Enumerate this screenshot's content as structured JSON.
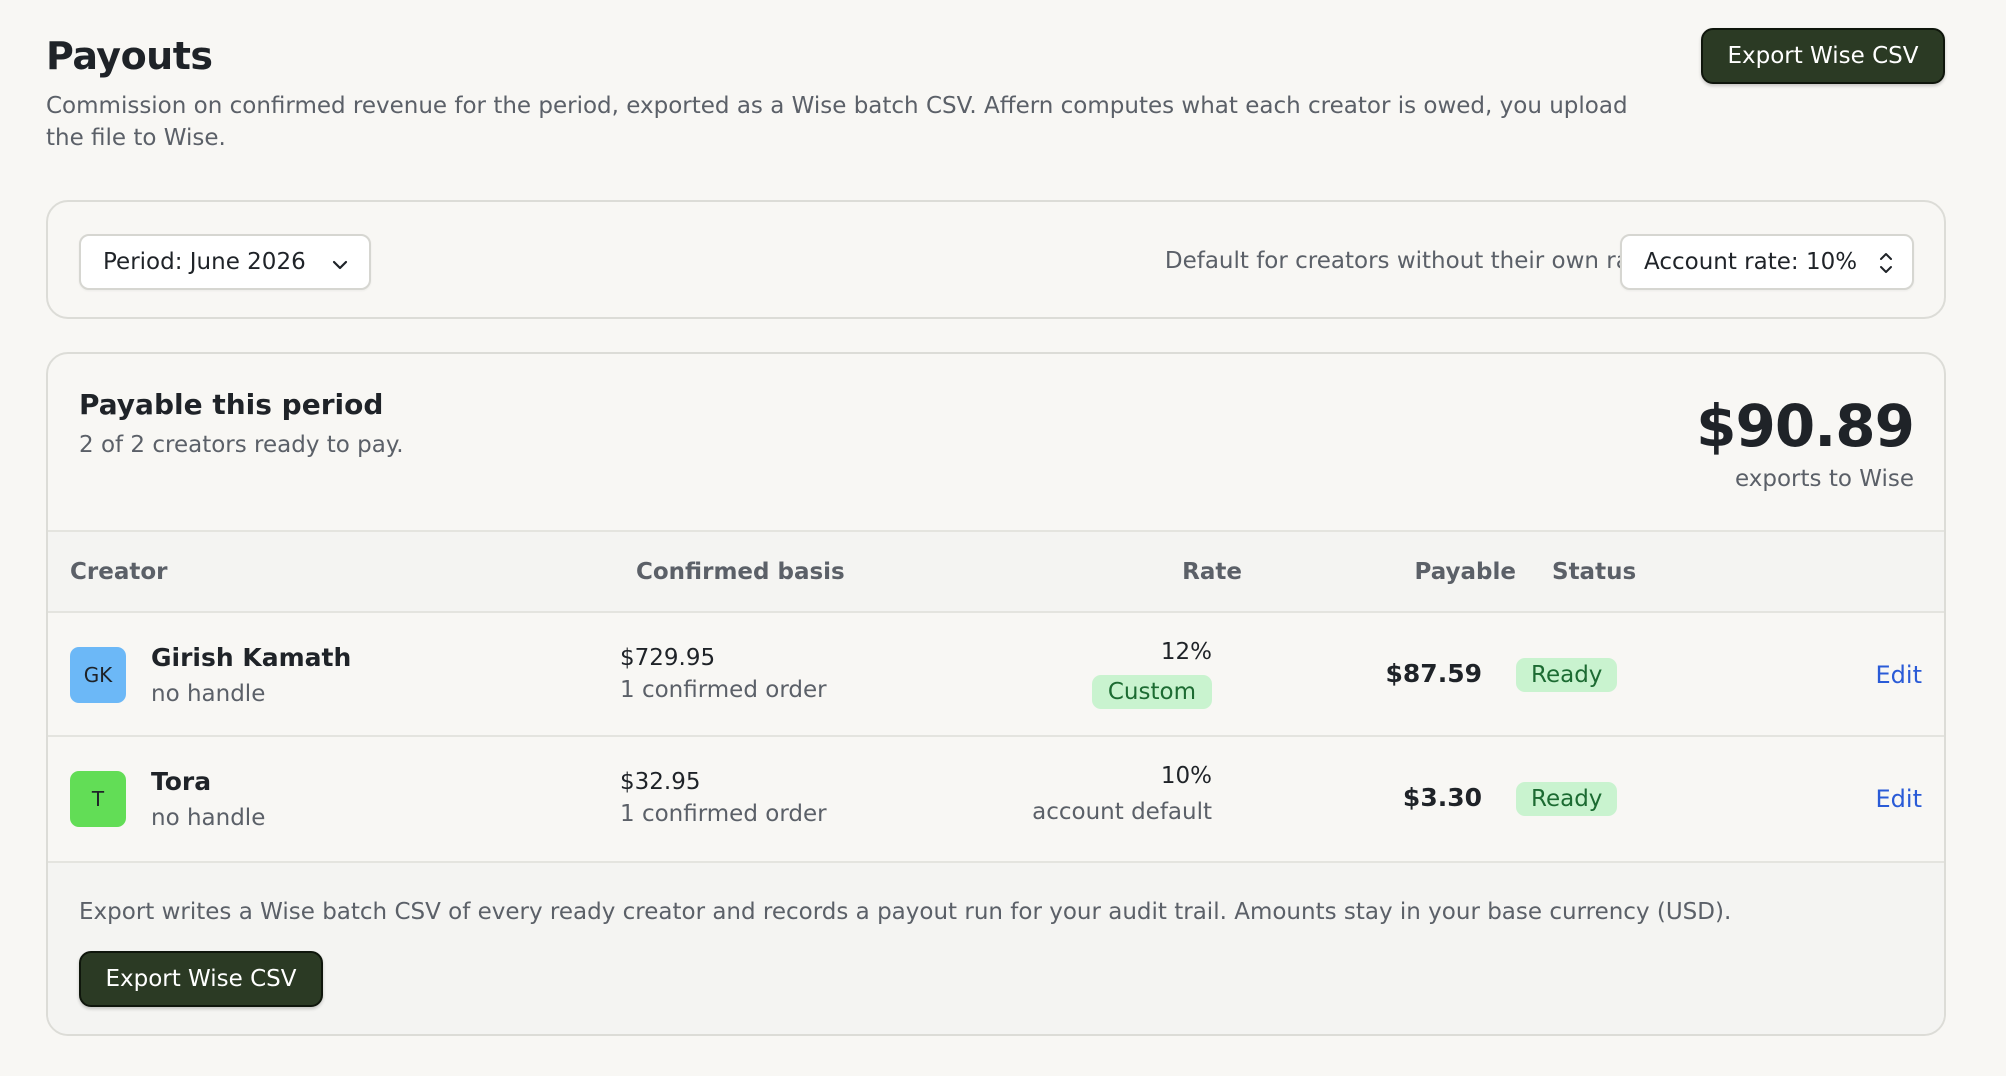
{
  "header": {
    "title": "Payouts",
    "subtitle": "Commission on confirmed revenue for the period, exported as a Wise batch CSV. Affern computes what each creator is owed, you upload the file to Wise.",
    "export_label": "Export Wise CSV"
  },
  "filters": {
    "period_label": "Period: June 2026",
    "rate_hint": "Default for creators without their own rate",
    "account_rate_label": "Account rate: 10%"
  },
  "summary": {
    "title": "Payable this period",
    "subtitle": "2 of 2 creators ready to pay.",
    "total": "$90.89",
    "total_caption": "exports to Wise"
  },
  "table": {
    "columns": {
      "creator": "Creator",
      "basis": "Confirmed basis",
      "rate": "Rate",
      "payable": "Payable",
      "status": "Status"
    },
    "rows": [
      {
        "initials": "GK",
        "avatar_color": "#6cb8f7",
        "name": "Girish Kamath",
        "handle": "no handle",
        "basis": "$729.95",
        "orders": "1 confirmed order",
        "rate": "12%",
        "rate_note": "Custom",
        "payable": "$87.59",
        "status": "Ready",
        "action": "Edit"
      },
      {
        "initials": "T",
        "avatar_color": "#62dd56",
        "name": "Tora",
        "handle": "no handle",
        "basis": "$32.95",
        "orders": "1 confirmed order",
        "rate": "10%",
        "rate_note": "account default",
        "payable": "$3.30",
        "status": "Ready",
        "action": "Edit"
      }
    ]
  },
  "footer": {
    "note": "Export writes a Wise batch CSV of every ready creator and records a payout run for your audit trail. Amounts stay in your base currency (USD).",
    "export_label": "Export Wise CSV"
  },
  "colors": {
    "accent_dark": "#2b3a24",
    "ready_bg": "#c9f3cf",
    "link": "#2a5bd7"
  },
  "icons": {
    "period_chevron": "chevron-down-icon",
    "rate_stepper": "chevron-up-down-icon"
  }
}
